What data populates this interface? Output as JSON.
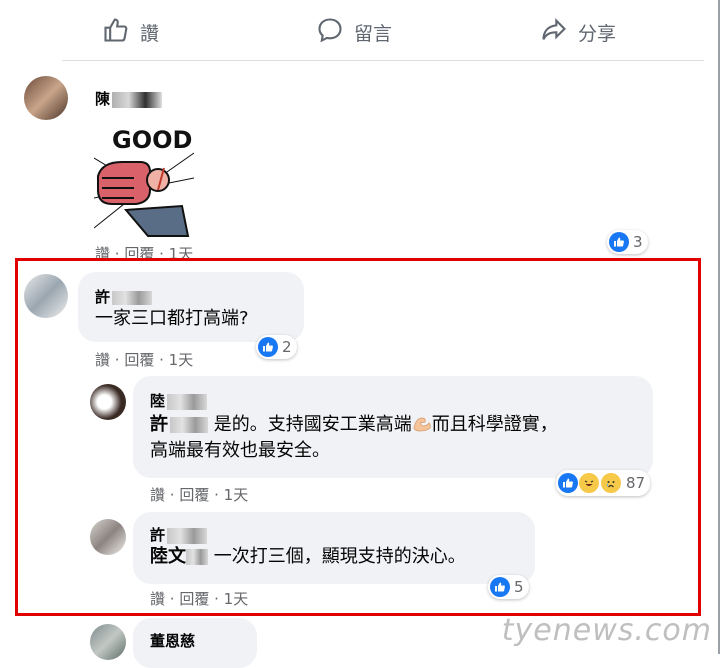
{
  "actions": {
    "like": "讚",
    "comment": "留言",
    "share": "分享"
  },
  "comments": [
    {
      "name": "陳",
      "meta": {
        "like": "讚",
        "dot": " · ",
        "reply": "回覆",
        "time": "1天"
      },
      "reactions": "3"
    },
    {
      "name": "許",
      "text": "一家三口都打高端?",
      "meta": {
        "like": "讚",
        "dot": " · ",
        "reply": "回覆",
        "time": "1天"
      },
      "reactions": "2"
    },
    {
      "name": "陸",
      "mention": "許",
      "text_line1": "是的。支持國安工業高端",
      "text_line1b": "而且科學證實，",
      "text_line2": "高端最有效也最安全。",
      "meta": {
        "like": "讚",
        "dot": " · ",
        "reply": "回覆",
        "time": "1天"
      },
      "reactions": "87"
    },
    {
      "name": "許",
      "mention": "陸文",
      "text": "一次打三個，顯現支持的決心。",
      "meta": {
        "like": "讚",
        "dot": " · ",
        "reply": "回覆",
        "time": "1天"
      },
      "reactions": "5"
    },
    {
      "name": "董恩慈"
    }
  ],
  "sticker": {
    "text": "GOOD"
  },
  "watermark": "tyenews.com",
  "colors": {
    "like_blue": "#1877f2",
    "highlight_red": "#e00000",
    "bubble": "#f0f2f5"
  }
}
